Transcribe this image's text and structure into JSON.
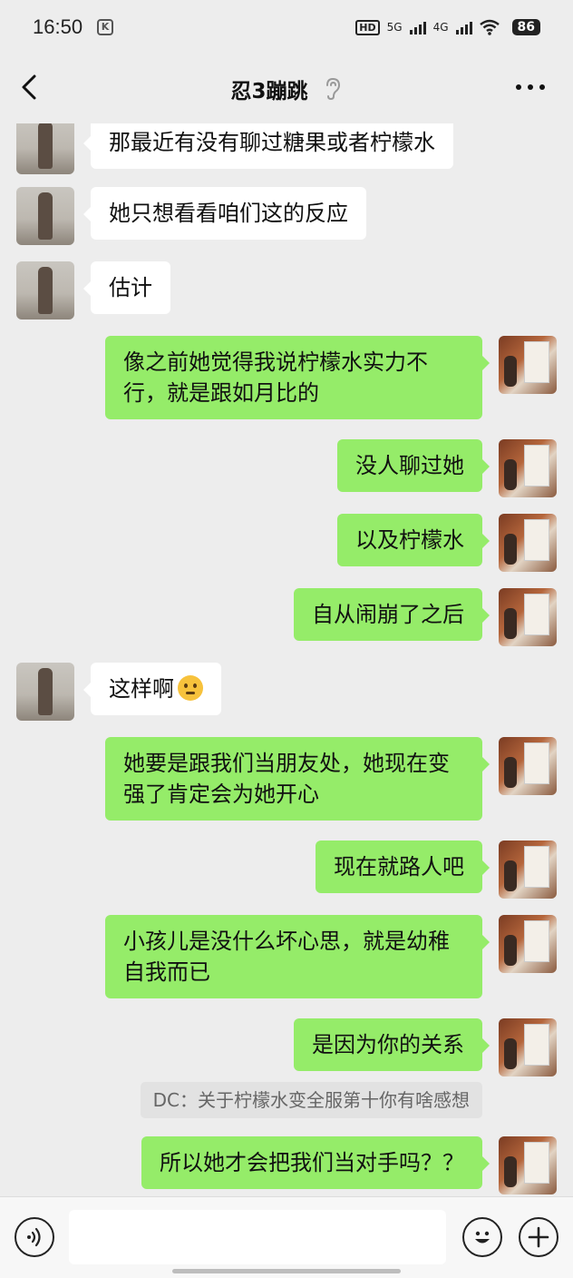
{
  "status_bar": {
    "time": "16:50",
    "app_badge": "K",
    "hd_label": "HD",
    "network_5g": "5G",
    "network_4g": "4G",
    "battery": "86"
  },
  "header": {
    "title": "忍3蹦跳"
  },
  "messages": [
    {
      "side": "left",
      "text": "那最近有没有聊过糖果或者柠檬水"
    },
    {
      "side": "left",
      "text": "她只想看看咱们这的反应"
    },
    {
      "side": "left",
      "text": "估计"
    },
    {
      "side": "right",
      "text": "像之前她觉得我说柠檬水实力不行，就是跟如月比的"
    },
    {
      "side": "right",
      "text": "没人聊过她"
    },
    {
      "side": "right",
      "text": "以及柠檬水"
    },
    {
      "side": "right",
      "text": "自从闹崩了之后"
    },
    {
      "side": "left",
      "text": "这样啊"
    },
    {
      "side": "right",
      "text": "她要是跟我们当朋友处，她现在变强了肯定会为她开心"
    },
    {
      "side": "right",
      "text": "现在就路人吧"
    },
    {
      "side": "right",
      "text": "小孩儿是没什么坏心思，就是幼稚自我而已"
    },
    {
      "side": "right",
      "text": "是因为你的关系"
    },
    {
      "side": "right",
      "text": "所以她才会把我们当对手吗？？"
    }
  ],
  "quote": {
    "text": "DC：关于柠檬水变全服第十你有啥感想"
  },
  "input_bar": {
    "placeholder": ""
  },
  "colors": {
    "background": "#ededed",
    "my_bubble": "#95ec69",
    "their_bubble": "#ffffff"
  }
}
